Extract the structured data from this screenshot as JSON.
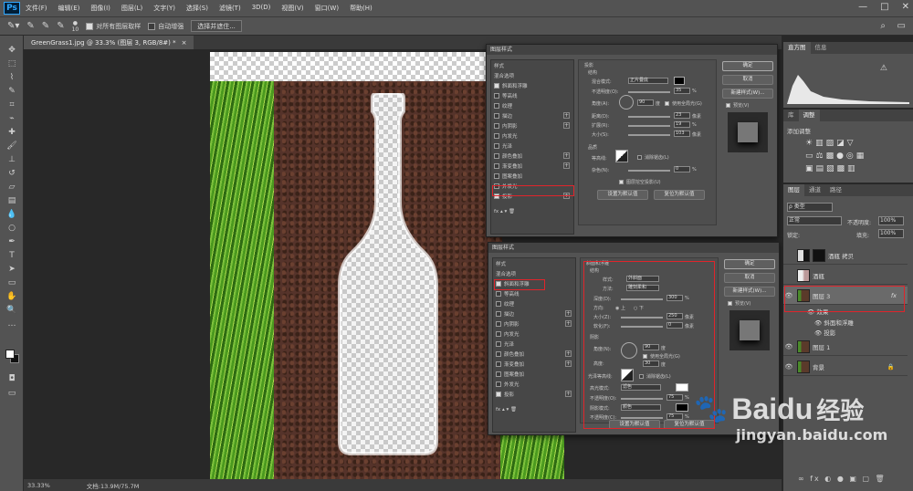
{
  "app": {
    "logo": "Ps"
  },
  "menu": [
    "文件(F)",
    "编辑(E)",
    "图像(I)",
    "图层(L)",
    "文字(Y)",
    "选择(S)",
    "滤镜(T)",
    "3D(D)",
    "视图(V)",
    "窗口(W)",
    "帮助(H)"
  ],
  "window_controls": [
    "—",
    "□",
    "✕"
  ],
  "options": {
    "brush_size": "10",
    "sample_all_layers": "对所有图层取样",
    "auto_enhance": "自动增强",
    "select_and_mask": "选择并遮住..."
  },
  "document": {
    "tab_title": "GreenGrass1.jpg @ 33.3% (图层 3, RGB/8#) *",
    "close": "×"
  },
  "status": {
    "zoom": "33.33%",
    "doc_size": "文档:13.9M/75.7M"
  },
  "dialog_top": {
    "title": "图层样式",
    "styles_header": "样式",
    "blend_options": "混合选项",
    "styles": [
      {
        "label": "斜面和浮雕",
        "checked": true,
        "plus": false
      },
      {
        "label": "等高线",
        "checked": false,
        "plus": false
      },
      {
        "label": "纹理",
        "checked": false,
        "plus": false
      },
      {
        "label": "描边",
        "checked": false,
        "plus": true
      },
      {
        "label": "内阴影",
        "checked": false,
        "plus": true
      },
      {
        "label": "内发光",
        "checked": false,
        "plus": false
      },
      {
        "label": "光泽",
        "checked": false,
        "plus": false
      },
      {
        "label": "颜色叠加",
        "checked": false,
        "plus": true
      },
      {
        "label": "渐变叠加",
        "checked": false,
        "plus": true
      },
      {
        "label": "图案叠加",
        "checked": false,
        "plus": false
      },
      {
        "label": "外发光",
        "checked": false,
        "plus": false
      },
      {
        "label": "投影",
        "checked": true,
        "plus": true
      }
    ],
    "section_shadow": "投影",
    "section_structure": "结构",
    "blend_mode_label": "混合模式:",
    "blend_mode": "正片叠底",
    "opacity_label": "不透明度(O):",
    "opacity": "35",
    "angle_label": "角度(A):",
    "angle": "90",
    "global_light": "使用全局光(G)",
    "distance_label": "距离(D):",
    "distance": "23",
    "spread_label": "扩展(R):",
    "spread": "19",
    "size_label": "大小(S):",
    "size": "103",
    "quality": "品质",
    "contour_label": "等高线:",
    "anti_alias": "消除锯齿(L)",
    "noise_label": "杂色(N):",
    "noise": "0",
    "knockout": "图层挖空投影(U)",
    "make_default": "设置为默认值",
    "reset_default": "复位为默认值",
    "ok": "确定",
    "cancel": "取消",
    "new_style": "新建样式(W)...",
    "preview": "预览(V)",
    "unit_pct": "%",
    "unit_px": "像素",
    "unit_deg": "度"
  },
  "dialog_bottom": {
    "title": "图层样式",
    "styles_header": "样式",
    "blend_options": "混合选项",
    "styles": [
      {
        "label": "斜面和浮雕",
        "checked": true,
        "plus": false
      },
      {
        "label": "等高线",
        "checked": false,
        "plus": false
      },
      {
        "label": "纹理",
        "checked": false,
        "plus": false
      },
      {
        "label": "描边",
        "checked": false,
        "plus": true
      },
      {
        "label": "内阴影",
        "checked": false,
        "plus": true
      },
      {
        "label": "内发光",
        "checked": false,
        "plus": false
      },
      {
        "label": "光泽",
        "checked": false,
        "plus": false
      },
      {
        "label": "颜色叠加",
        "checked": false,
        "plus": true
      },
      {
        "label": "渐变叠加",
        "checked": false,
        "plus": true
      },
      {
        "label": "图案叠加",
        "checked": false,
        "plus": false
      },
      {
        "label": "外发光",
        "checked": false,
        "plus": false
      },
      {
        "label": "投影",
        "checked": true,
        "plus": true
      }
    ],
    "section_bevel": "斜面和浮雕",
    "section_structure": "结构",
    "style_label": "样式:",
    "style": "外斜面",
    "technique_label": "方法:",
    "technique": "雕刻柔和",
    "depth_label": "深度(D):",
    "depth": "300",
    "direction_label": "方向:",
    "dir_up": "上",
    "dir_down": "下",
    "size_label": "大小(Z):",
    "size": "250",
    "soften_label": "软化(F):",
    "soften": "0",
    "section_shading": "阴影",
    "angle_label": "角度(N):",
    "angle": "90",
    "global_light": "使用全局光(G)",
    "altitude_label": "高度:",
    "altitude": "30",
    "gloss_label": "光泽等高线:",
    "anti_alias": "消除锯齿(L)",
    "highlight_label": "高光模式:",
    "highlight": "滤色",
    "hl_opacity_label": "不透明度(O):",
    "hl_opacity": "75",
    "shadow_label": "阴影模式:",
    "shadow": "颜色",
    "sh_opacity_label": "不透明度(C):",
    "sh_opacity": "75",
    "make_default": "设置为默认值",
    "reset_default": "复位为默认值",
    "ok": "确定",
    "cancel": "取消",
    "new_style": "新建样式(W)...",
    "preview": "预览(V)",
    "unit_pct": "%",
    "unit_px": "像素",
    "unit_deg": "度"
  },
  "right": {
    "tabs_top": [
      "直方图",
      "信息"
    ],
    "tabs_mid": [
      "库",
      "调整"
    ],
    "adjust_title": "添加调整",
    "tabs_layers": [
      "图层",
      "通道",
      "路径"
    ],
    "filter_kind": "ρ 类型",
    "blend_mode": "正常",
    "opacity_label": "不透明度:",
    "opacity": "100%",
    "lock_label": "锁定:",
    "fill_label": "填充:",
    "fill": "100%",
    "layers": [
      {
        "name": "酒瓶 拷贝",
        "fx": false,
        "selected": false
      },
      {
        "name": "酒瓶",
        "fx": false,
        "selected": false
      },
      {
        "name": "图层 3",
        "fx": true,
        "selected": true
      },
      {
        "name": "图层 1",
        "fx": false,
        "selected": false
      },
      {
        "name": "背景",
        "fx": false,
        "selected": false
      }
    ],
    "effects_label": "效果",
    "effect_items": [
      "斜面和浮雕",
      "投影"
    ],
    "fx": "fx",
    "bottom_icons": "∞  fx  ◐  ●  ▣  ▢  🗑"
  },
  "watermark": {
    "brand": "Baidu",
    "cn": "经验",
    "url": "jingyan.baidu.com"
  }
}
